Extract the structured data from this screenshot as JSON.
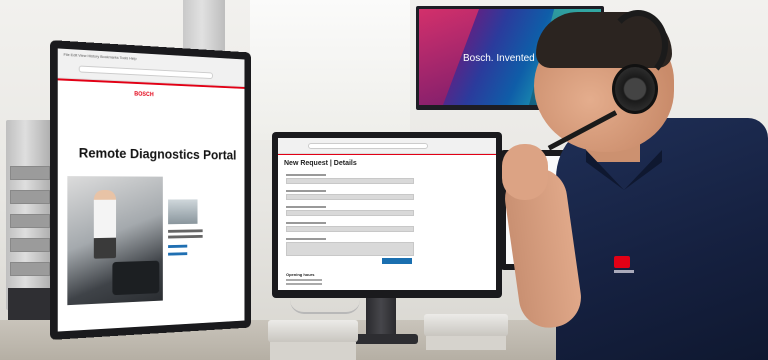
{
  "scene": {
    "description_colors": {
      "bosch_red": "#e20015",
      "shirt_navy": "#15203f",
      "accent_blue": "#1a6fb0"
    }
  },
  "tv": {
    "slogan": "Bosch. Invented for"
  },
  "left_monitor": {
    "browser_menu": "File  Edit  View  History  Bookmarks  Tools  Help",
    "brand": "BOSCH",
    "portal_title": "Remote Diagnostics Portal"
  },
  "middle_monitor": {
    "form_title": "New Request | Details",
    "hours_title": "Opening hours"
  }
}
